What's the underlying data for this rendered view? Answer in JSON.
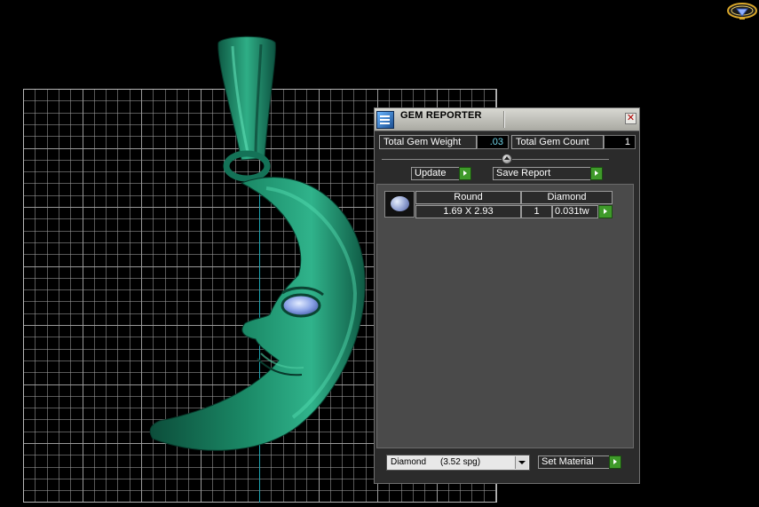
{
  "panel": {
    "title": "GEM REPORTER",
    "total_weight_label": "Total Gem Weight",
    "total_weight_value": ".03",
    "total_count_label": "Total Gem Count",
    "total_count_value": "1",
    "update_label": "Update",
    "save_report_label": "Save Report",
    "table": {
      "header_shape": "Round",
      "header_material": "Diamond",
      "size": "1.69 X 2.93",
      "count": "1",
      "weight": "0.031tw"
    },
    "material_select": {
      "name": "Diamond",
      "sg": "(3.52 spg)"
    },
    "set_material_label": "Set Material"
  },
  "colors": {
    "pendant": "#17775a",
    "grid": "#bdbdbd",
    "panel_bg": "#2b2b2b",
    "list_bg": "#4a4a4a",
    "accent_green": "#3f9a2a",
    "value_cyan": "#6fd3e6"
  },
  "icons": {
    "app": "gem-reporter-icon",
    "close": "close-icon",
    "gem": "round-gem-icon",
    "logo": "gem-logo-icon"
  }
}
